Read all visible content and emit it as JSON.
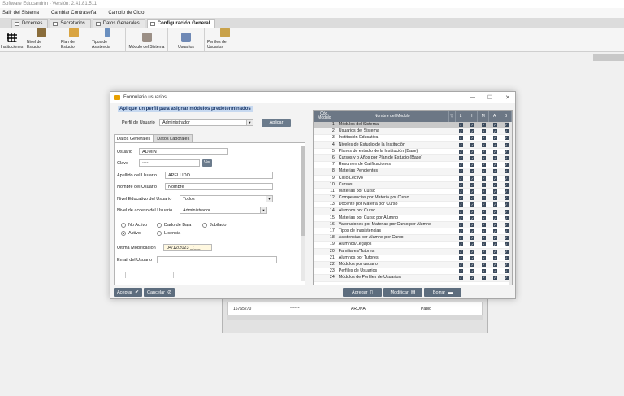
{
  "app": {
    "title": "Software Educandrín - Versión: 2.41.81.511"
  },
  "menu": [
    "Salir del Sistema",
    "Cambiar Contraseña",
    "Cambio de Ciclo"
  ],
  "tabs": [
    {
      "label": "Docentes",
      "active": false
    },
    {
      "label": "Secretarios",
      "active": false
    },
    {
      "label": "Datos Generales",
      "active": false
    },
    {
      "label": "Configuración General",
      "active": true
    }
  ],
  "toolbar": [
    {
      "label": "Instituciones",
      "icon": "grid-icon"
    },
    {
      "label": "Nivel de Estudio",
      "icon": "folders-icon"
    },
    {
      "label": "Plan de Estudio",
      "icon": "book-icon"
    },
    {
      "label": "Tipos de Asistencia",
      "icon": "pin-icon"
    },
    {
      "label": "Módulo del Sistema",
      "icon": "module-icon"
    },
    {
      "label": "Usuarios",
      "icon": "users-icon"
    },
    {
      "label": "Perfiles de Usuarios",
      "icon": "user-profile-icon"
    }
  ],
  "background_grid": {
    "row": [
      "16765270",
      "******",
      "ARONA",
      "Pablo"
    ]
  },
  "dialog": {
    "title": "Formulario usuarios",
    "banner": "Aplique un perfil para asignar módulos predeterminados",
    "profile_label": "Perfil de Usuario",
    "profile_value": "Administrador",
    "apply_label": "Aplicar",
    "inner_tabs": [
      {
        "label": "Datos Generales",
        "active": true
      },
      {
        "label": "Datos Laborales",
        "active": false
      }
    ],
    "form": {
      "usuario_label": "Usuario",
      "usuario_value": "ADMIN",
      "clave_label": "Clave",
      "clave_value": "••••",
      "ver_label": "Ver",
      "apellido_label": "Apellido del Usuario",
      "apellido_value": "APELLIDO",
      "nombre_label": "Nombre del Usuario",
      "nombre_value": "Nombre",
      "nivel_educativo_label": "Nivel Educativo del Usuario",
      "nivel_educativo_value": "Todos",
      "nivel_acceso_label": "Nivel de acceso del Usuario",
      "nivel_acceso_value": "Administrador",
      "status_options": [
        {
          "label": "No Activo",
          "checked": false
        },
        {
          "label": "Dado de Baja",
          "checked": false
        },
        {
          "label": "Jubilado",
          "checked": false
        },
        {
          "label": "Activo",
          "checked": true
        },
        {
          "label": "Licencia",
          "checked": false
        }
      ],
      "ultima_mod_label": "Ultima Modificación",
      "ultima_mod_value": "04/12/2023 _:_:_",
      "email_label": "Email del Usuario",
      "email_value": ""
    },
    "footer": {
      "aceptar": "Aceptar",
      "cancelar": "Cancelar",
      "agregar": "Agregar",
      "modificar": "Modificar",
      "borrar": "Borrar"
    },
    "modules_grid": {
      "headers": {
        "code": "Cód. Módulo",
        "name": "Nombre del Módulo",
        "perms": [
          "L",
          "I",
          "M",
          "A",
          "B"
        ]
      },
      "rows": [
        {
          "n": "1",
          "name": "Módulos del Sistema"
        },
        {
          "n": "2",
          "name": "Usuarios del Sistema"
        },
        {
          "n": "3",
          "name": "Institución Educativa"
        },
        {
          "n": "4",
          "name": "Niveles de Estudio de la Institución"
        },
        {
          "n": "5",
          "name": "Planes de estudio de la Institución (Base)"
        },
        {
          "n": "6",
          "name": "Cursos y o Años por Plan de Estudio (Base)"
        },
        {
          "n": "7",
          "name": "Resumen de Calificaciones"
        },
        {
          "n": "8",
          "name": "Materias Pendientes"
        },
        {
          "n": "9",
          "name": "Ciclo Lectivo"
        },
        {
          "n": "10",
          "name": "Cursos"
        },
        {
          "n": "11",
          "name": "Materias por Curso"
        },
        {
          "n": "12",
          "name": "Competencias por Materia por Curso"
        },
        {
          "n": "13",
          "name": "Docente por Materia por Curso"
        },
        {
          "n": "14",
          "name": "Alumnos por Curso"
        },
        {
          "n": "15",
          "name": "Materias por Curso por Alumno"
        },
        {
          "n": "16",
          "name": "Valoraciones por Materias por Curso por Alumno"
        },
        {
          "n": "17",
          "name": "Tipos de Inasistencias"
        },
        {
          "n": "18",
          "name": "Asistencias por Alumno por Curso"
        },
        {
          "n": "19",
          "name": "Alumnos/Legajos"
        },
        {
          "n": "20",
          "name": "Familiares/Tutores"
        },
        {
          "n": "21",
          "name": "Alumnos por Tutores"
        },
        {
          "n": "22",
          "name": "Módulos por usuario"
        },
        {
          "n": "23",
          "name": "Perfiles de Usuarios"
        },
        {
          "n": "24",
          "name": "Módulos de Perfiles de Usuarios"
        }
      ]
    }
  }
}
